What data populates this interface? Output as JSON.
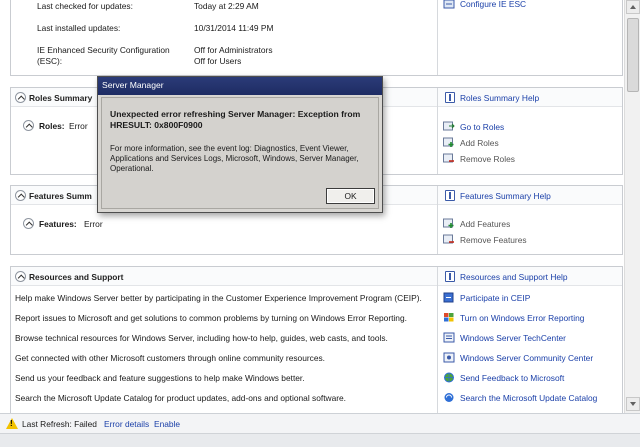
{
  "top": {
    "last_checked_label": "Last checked for updates:",
    "last_checked_value": "Today at 2:29 AM",
    "last_installed_label": "Last installed updates:",
    "last_installed_value": "10/31/2014 11:49 PM",
    "ie_esc_label_1": "IE Enhanced Security Configuration",
    "ie_esc_label_2": "(ESC):",
    "ie_esc_value_1": "Off for Administrators",
    "ie_esc_value_2": "Off for Users",
    "configure_ie_esc": "Configure IE ESC"
  },
  "roles": {
    "title": "Roles Summary",
    "help": "Roles Summary Help",
    "label": "Roles:",
    "status": "Error",
    "actions": [
      "Go to Roles",
      "Add Roles",
      "Remove Roles"
    ]
  },
  "features": {
    "title": "Features Summ",
    "help": "Features Summary Help",
    "label": "Features:",
    "status": "Error",
    "actions": [
      "Add Features",
      "Remove Features"
    ]
  },
  "resources": {
    "title": "Resources and Support",
    "help": "Resources and Support Help",
    "rows": [
      {
        "text": "Help make Windows Server better by participating in the Customer Experience Improvement Program (CEIP).",
        "link": "Participate in CEIP"
      },
      {
        "text": "Report issues to Microsoft and get solutions to common problems by turning on Windows Error Reporting.",
        "link": "Turn on Windows Error Reporting"
      },
      {
        "text": "Browse technical resources for Windows Server, including how-to help, guides, web casts, and tools.",
        "link": "Windows Server TechCenter"
      },
      {
        "text": "Get connected with other Microsoft customers through online community resources.",
        "link": "Windows Server Community Center"
      },
      {
        "text": "Send us your feedback and feature suggestions to help make Windows better.",
        "link": "Send Feedback to Microsoft"
      },
      {
        "text": "Search the Microsoft Update Catalog for product updates, add-ons and optional software.",
        "link": "Search the Microsoft Update Catalog"
      }
    ]
  },
  "status_bar": {
    "last_refresh": "Last Refresh: Failed",
    "error_details": "Error details",
    "enable": "Enable"
  },
  "dialog": {
    "title": "Server Manager",
    "error_message": "Unexpected error refreshing Server Manager: Exception from HRESULT: 0x800F0900",
    "info_message": "For more information, see the event log: Diagnostics, Event Viewer, Applications and Services Logs, Microsoft, Windows, Server Manager, Operational.",
    "ok_label": "OK"
  },
  "colors": {
    "link": "#1a3fa8",
    "dialog_title_bar": "#23336d",
    "dialog_body": "#d4d2ce",
    "warning": "#f2c200"
  }
}
